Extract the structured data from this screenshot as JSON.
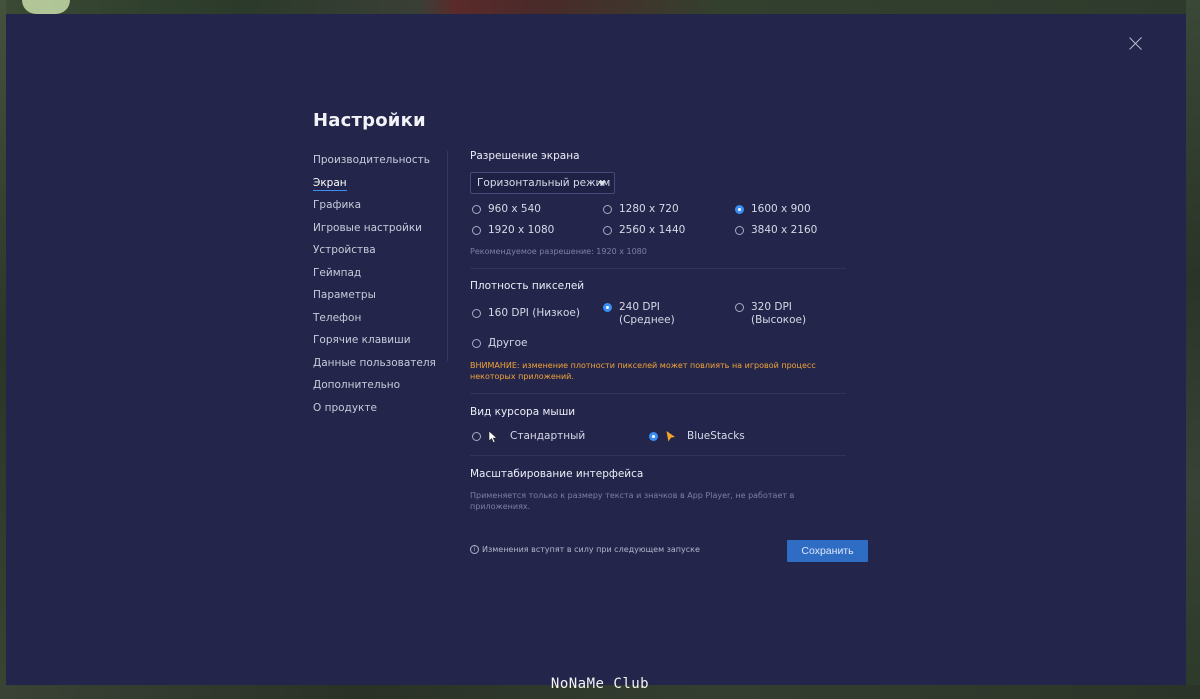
{
  "dialog": {
    "title": "Настройки"
  },
  "nav": {
    "items": [
      {
        "label": "Производительность",
        "active": false
      },
      {
        "label": "Экран",
        "active": true
      },
      {
        "label": "Графика",
        "active": false
      },
      {
        "label": "Игровые настройки",
        "active": false
      },
      {
        "label": "Устройства",
        "active": false
      },
      {
        "label": "Геймпад",
        "active": false
      },
      {
        "label": "Параметры",
        "active": false
      },
      {
        "label": "Телефон",
        "active": false
      },
      {
        "label": "Горячие клавиши",
        "active": false
      },
      {
        "label": "Данные пользователя",
        "active": false
      },
      {
        "label": "Дополнительно",
        "active": false
      },
      {
        "label": "О продукте",
        "active": false
      }
    ]
  },
  "resolution": {
    "title": "Разрешение экрана",
    "mode_selected": "Горизонтальный режим",
    "options": [
      {
        "label": "960 x 540",
        "checked": false
      },
      {
        "label": "1280 x 720",
        "checked": false
      },
      {
        "label": "1600 x 900",
        "checked": true
      },
      {
        "label": "1920 x 1080",
        "checked": false
      },
      {
        "label": "2560 x 1440",
        "checked": false
      },
      {
        "label": "3840 x 2160",
        "checked": false
      }
    ],
    "recommended": "Рекомендуемое разрешение: 1920 x 1080"
  },
  "dpi": {
    "title": "Плотность пикселей",
    "options": [
      {
        "line1": "160 DPI (Низкое)",
        "line2": "",
        "checked": false
      },
      {
        "line1": "240 DPI",
        "line2": "(Среднее)",
        "checked": true
      },
      {
        "line1": "320 DPI",
        "line2": "(Высокое)",
        "checked": false
      },
      {
        "line1": "Другое",
        "line2": "",
        "checked": false
      }
    ],
    "warning_line1": "ВНИМАНИЕ: изменение плотности пикселей может повлиять на игровой процесс",
    "warning_line2": "некоторых приложений."
  },
  "cursor": {
    "title": "Вид курсора мыши",
    "options": [
      {
        "label": "Стандартный",
        "checked": false,
        "icon": "arrow-cursor-icon"
      },
      {
        "label": "BlueStacks",
        "checked": true,
        "icon": "bluestacks-cursor-icon"
      }
    ]
  },
  "scaling": {
    "title": "Масштабирование интерфейса",
    "hint_line1": "Применяется только к размеру текста и значков в App Player, не работает в",
    "hint_line2": "приложениях."
  },
  "footer": {
    "note": "Изменения вступят в силу при следующем запуске",
    "save_label": "Сохранить"
  },
  "watermark": "NoNaMe Club",
  "colors": {
    "dialog_bg": "#23264a",
    "accent": "#3b8ef3",
    "save_button": "#2f6cc4",
    "warning": "#f1a33a"
  }
}
